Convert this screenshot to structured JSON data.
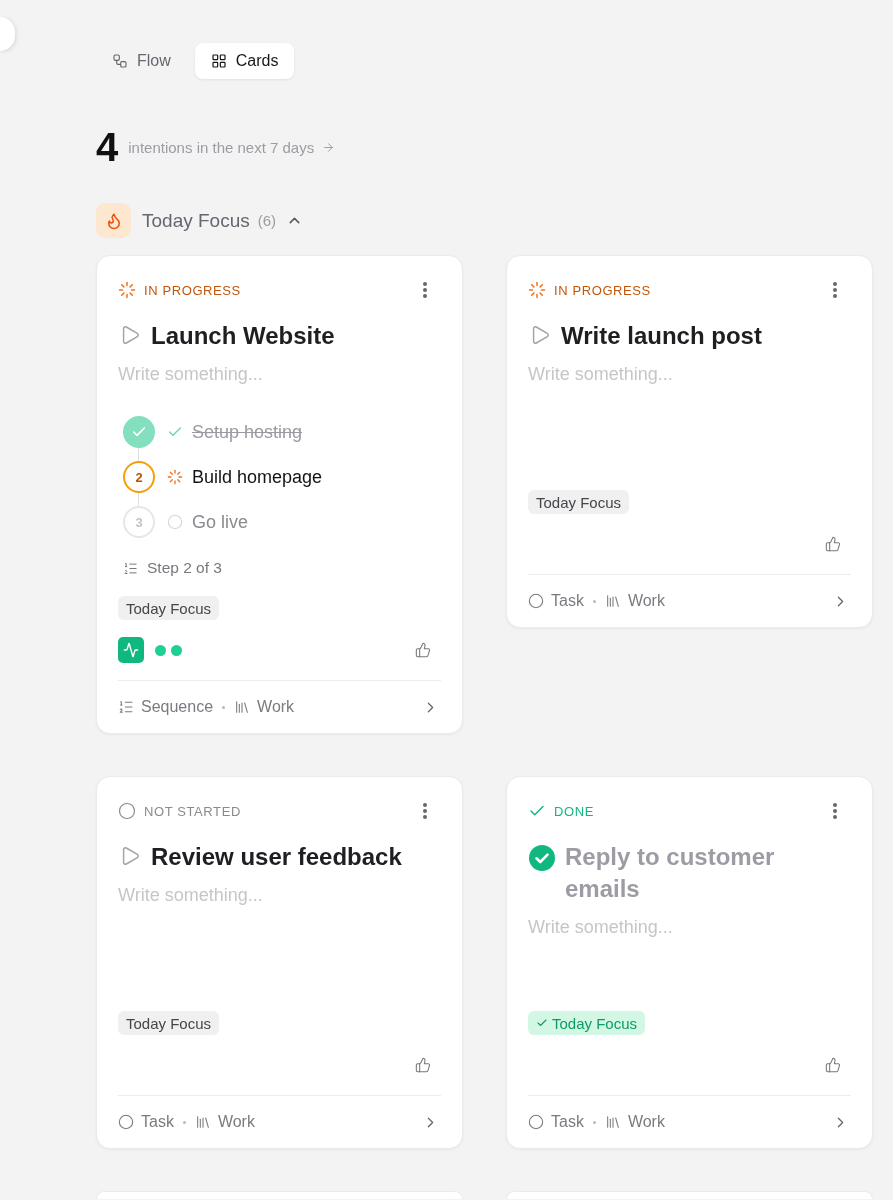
{
  "view_switch": [
    {
      "kind": "flow",
      "label": "Flow",
      "selected": false
    },
    {
      "kind": "cards",
      "label": "Cards",
      "selected": true
    }
  ],
  "summary": {
    "count": "4",
    "text": "intentions in the next 7 days"
  },
  "section": {
    "title": "Today Focus",
    "count": "(6)",
    "expanded": true,
    "more_below": true
  },
  "cards": [
    {
      "status": {
        "kind": "in_progress",
        "label": "IN PROGRESS"
      },
      "title": "Launch Website",
      "description": {
        "placeholder": "Write something..."
      },
      "steps": [
        {
          "kind": "done",
          "label": "Setup hosting"
        },
        {
          "kind": "active",
          "number": "2",
          "label": "Build homepage"
        },
        {
          "kind": "pending",
          "number": "3",
          "label": "Go live"
        }
      ],
      "progress": "Step 2 of 3",
      "tags": [
        {
          "label": "Today Focus",
          "checked": false
        }
      ],
      "activity": {
        "dots": [
          {
            "on": true
          },
          {
            "on": true
          }
        ]
      },
      "footer": {
        "kind": "sequence",
        "type": "Sequence",
        "area": "Work"
      }
    },
    {
      "status": {
        "kind": "in_progress",
        "label": "IN PROGRESS"
      },
      "title": "Write launch post",
      "description": {
        "placeholder": "Write something..."
      },
      "tags": [
        {
          "label": "Today Focus",
          "checked": false
        }
      ],
      "footer": {
        "kind": "task",
        "type": "Task",
        "area": "Work"
      }
    },
    {
      "status": {
        "kind": "not_started",
        "label": "NOT STARTED"
      },
      "title": "Review user feedback",
      "description": {
        "placeholder": "Write something..."
      },
      "tags": [
        {
          "label": "Today Focus",
          "checked": false
        }
      ],
      "footer": {
        "kind": "task",
        "type": "Task",
        "area": "Work"
      }
    },
    {
      "status": {
        "kind": "done",
        "label": "DONE"
      },
      "title": "Reply to customer emails",
      "description": {
        "placeholder": "Write something..."
      },
      "tags": [
        {
          "label": "Today Focus",
          "checked": true
        }
      ],
      "footer": {
        "kind": "task",
        "type": "Task",
        "area": "Work"
      }
    }
  ]
}
